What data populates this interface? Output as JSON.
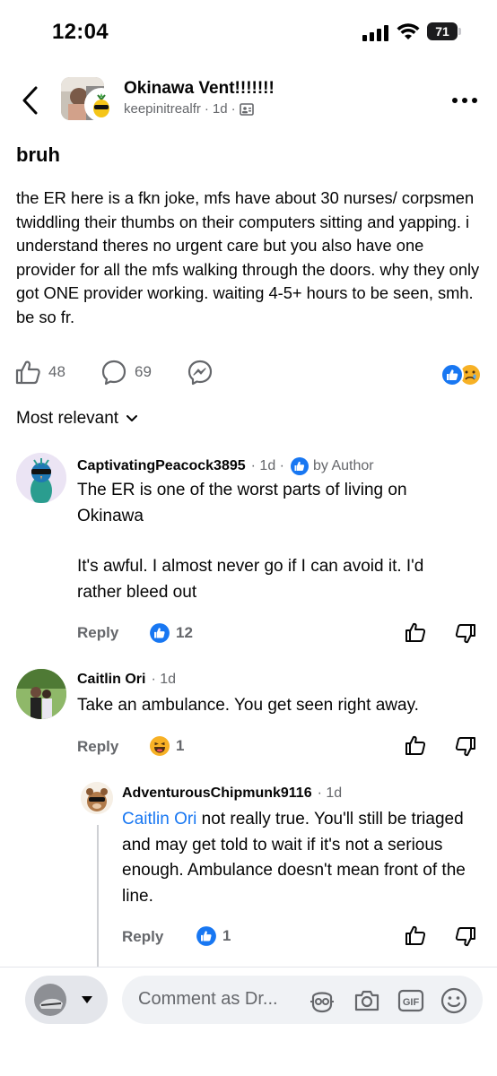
{
  "status": {
    "time": "12:04",
    "battery": "71"
  },
  "post": {
    "group_name": "Okinawa Vent!!!!!!!",
    "author": "keepinitrealfr",
    "time": "1d",
    "meta_sep": "·",
    "title": "bruh",
    "body": "the ER here is a fkn joke, mfs have about 30 nurses/ corpsmen twiddling their thumbs on their computers sitting and yapping. i understand theres no urgent care but you also have one provider for all the mfs walking through the doors. why they only got ONE provider working. waiting 4-5+ hours to be seen, smh. be so fr.",
    "likes": "48",
    "comments": "69"
  },
  "sort_label": "Most relevant",
  "comments": [
    {
      "name": "CaptivatingPeacock3895",
      "time": "· 1d ·",
      "author_badge": "by Author",
      "text_line1": "The ER is one of the worst parts of living on Okinawa",
      "text_line2": "It's awful. I almost never go if I can avoid it. I'd rather bleed out",
      "reply_label": "Reply",
      "reaction_count": "12"
    },
    {
      "name": "Caitlin Ori",
      "time": "· 1d",
      "text": "Take an ambulance. You get seen right away.",
      "reply_label": "Reply",
      "reaction_count": "1"
    },
    {
      "name": "AdventurousChipmunk9116",
      "time": "· 1d",
      "mention": "Caitlin Ori",
      "text": " not really true. You'll still be triaged and may get told to wait if it's not a serious enough. Ambulance doesn't mean front of the line.",
      "reply_label": "Reply",
      "reaction_count": "1"
    }
  ],
  "composer": {
    "placeholder": "Comment as Dr..."
  },
  "colors": {
    "accent": "#1877f2",
    "muted": "#65676b",
    "haha": "#f7b125"
  }
}
